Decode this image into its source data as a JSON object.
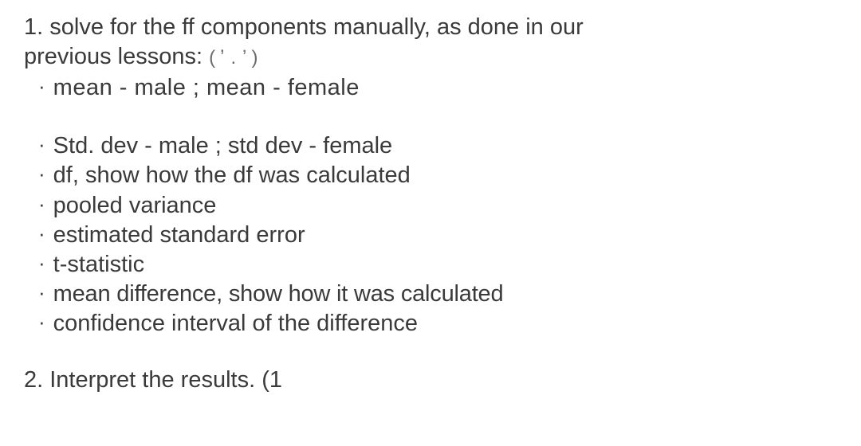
{
  "section1": {
    "heading_line1": "1. solve for the ff components manually, as done in our",
    "heading_line2_prefix": "previous lessons: ",
    "heading_line2_scribble": "(  ̕  .    ̛  )",
    "bullets_group1": [
      "mean - male ;  mean - female"
    ],
    "bullets_group2": [
      "Std. dev - male ; std dev - female",
      "df, show how the df was calculated",
      "pooled variance",
      "estimated standard error",
      "t-statistic",
      "mean difference,  show how it was calculated",
      "confidence interval of the difference"
    ]
  },
  "section2": {
    "text_main": "2. Interpret the results.   ",
    "trailing_mark": "(1"
  }
}
